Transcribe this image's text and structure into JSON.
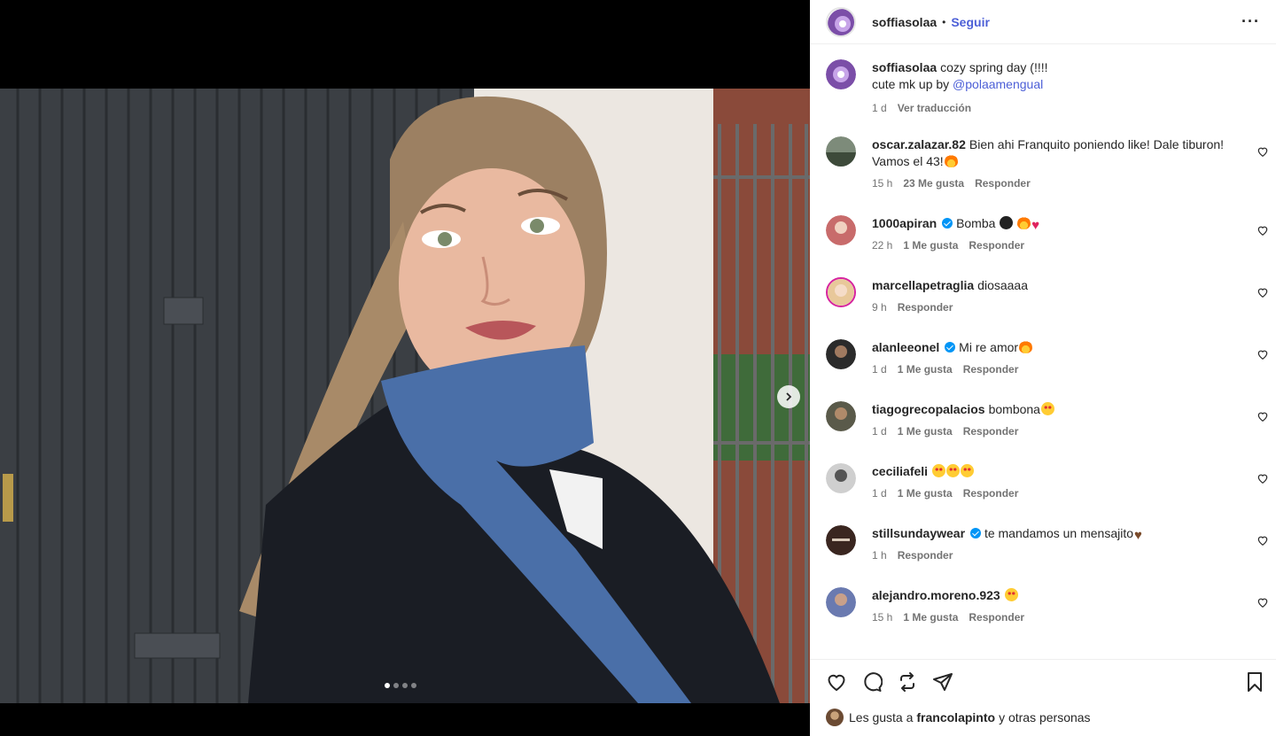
{
  "post": {
    "author": "soffiasolaa",
    "follow_label": "Seguir",
    "separator": "•",
    "more_label": "···",
    "media_dots": 4,
    "active_dot": 0
  },
  "caption": {
    "username": "soffiasolaa",
    "line1": "cozy spring day (!!!!",
    "line2_prefix": "cute mk up by ",
    "mention": "@polaamengual",
    "time": "1 d",
    "translate": "Ver traducción"
  },
  "comments": [
    {
      "username": "oscar.zalazar.82",
      "verified": false,
      "text": "Bien ahi Franquito poniendo like! Dale tiburon! Vamos el 43!",
      "time": "15 h",
      "likes": "23 Me gusta",
      "reply": "Responder"
    },
    {
      "username": "1000apiran",
      "verified": true,
      "text": "Bomba",
      "time": "22 h",
      "likes": "1 Me gusta",
      "reply": "Responder"
    },
    {
      "username": "marcellapetraglia",
      "verified": false,
      "text": "diosaaaa",
      "time": "9 h",
      "likes": "",
      "reply": "Responder"
    },
    {
      "username": "alanleeonel",
      "verified": true,
      "text": "Mi re amor",
      "time": "1 d",
      "likes": "1 Me gusta",
      "reply": "Responder"
    },
    {
      "username": "tiagogrecopalacios",
      "verified": false,
      "text": "bombona",
      "time": "1 d",
      "likes": "1 Me gusta",
      "reply": "Responder"
    },
    {
      "username": "ceciliafeli",
      "verified": false,
      "text": "",
      "time": "1 d",
      "likes": "1 Me gusta",
      "reply": "Responder"
    },
    {
      "username": "stillsundaywear",
      "verified": true,
      "text": "te mandamos un mensajito",
      "time": "1 h",
      "likes": "",
      "reply": "Responder"
    },
    {
      "username": "alejandro.moreno.923",
      "verified": false,
      "text": "",
      "time": "15 h",
      "likes": "1 Me gusta",
      "reply": "Responder"
    }
  ],
  "likes_line": {
    "prefix": "Les gusta a",
    "user": "francolapinto",
    "suffix": "y otras personas"
  },
  "colors": {
    "accent": "#4c5fd7",
    "verified": "#0095f6",
    "muted": "#737373",
    "scarf": "#4a6fa8",
    "coat": "#1a1d24"
  }
}
